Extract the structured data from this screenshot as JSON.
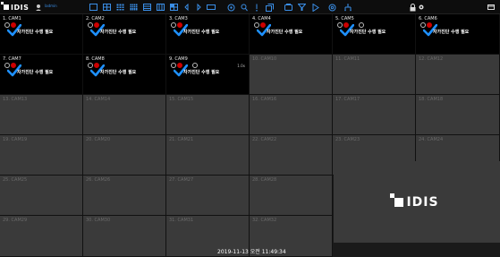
{
  "app": {
    "logo_text": "IDIS",
    "user_label": "Iadmin"
  },
  "timestamp": "2019-11-13 오전 11:49:34",
  "logo_panel_text": "IDIS",
  "cells": [
    {
      "title": "1. CAM1",
      "state": "active",
      "warning": "자가진단 수행 필요",
      "extra": false,
      "speed": ""
    },
    {
      "title": "2. CAM2",
      "state": "active",
      "warning": "자가진단 수행 필요",
      "extra": false,
      "speed": ""
    },
    {
      "title": "3. CAM3",
      "state": "active",
      "warning": "자가진단 수행 필요",
      "extra": false,
      "speed": ""
    },
    {
      "title": "4. CAM4",
      "state": "active",
      "warning": "자가진단 수행 필요",
      "extra": false,
      "speed": ""
    },
    {
      "title": "5. CAM5",
      "state": "active",
      "warning": "자가진단 수행 필요",
      "extra": true,
      "speed": ""
    },
    {
      "title": "6. CAM6",
      "state": "active",
      "warning": "자가진단 수행 필요",
      "extra": false,
      "speed": ""
    },
    {
      "title": "7. CAM7",
      "state": "active",
      "warning": "자가진단 수행 필요",
      "extra": false,
      "speed": ""
    },
    {
      "title": "8. CAM8",
      "state": "active",
      "warning": "자가진단 수행 필요",
      "extra": false,
      "speed": ""
    },
    {
      "title": "9. CAM9",
      "state": "active",
      "warning": "자가진단 수행 필요",
      "extra": true,
      "speed": "1.0x"
    },
    {
      "title": "10. CAM10",
      "state": "empty"
    },
    {
      "title": "11. CAM11",
      "state": "empty"
    },
    {
      "title": "12. CAM12",
      "state": "empty"
    },
    {
      "title": "13. CAM13",
      "state": "empty"
    },
    {
      "title": "14. CAM14",
      "state": "empty"
    },
    {
      "title": "15. CAM15",
      "state": "empty"
    },
    {
      "title": "16. CAM16",
      "state": "empty"
    },
    {
      "title": "17. CAM17",
      "state": "empty"
    },
    {
      "title": "18. CAM18",
      "state": "empty"
    },
    {
      "title": "19. CAM19",
      "state": "empty"
    },
    {
      "title": "20. CAM20",
      "state": "empty"
    },
    {
      "title": "21. CAM21",
      "state": "empty"
    },
    {
      "title": "22. CAM22",
      "state": "empty"
    },
    {
      "title": "23. CAM23",
      "state": "empty"
    },
    {
      "title": "24. CAM24",
      "state": "empty"
    },
    {
      "title": "25. CAM25",
      "state": "empty"
    },
    {
      "title": "26. CAM26",
      "state": "empty"
    },
    {
      "title": "27. CAM27",
      "state": "empty"
    },
    {
      "title": "28. CAM28",
      "state": "empty"
    },
    {
      "title": "29. CAM29",
      "state": "empty"
    },
    {
      "title": "30. CAM30",
      "state": "empty"
    },
    {
      "title": "31. CAM31",
      "state": "empty"
    },
    {
      "title": "32. CAM32",
      "state": "empty"
    }
  ],
  "toolbar_icons": [
    "split-1x1-icon",
    "split-2x2-icon",
    "split-3x3-icon",
    "split-4x4-icon",
    "split-5x5-icon",
    "split-6x6-icon",
    "split-custom-icon",
    "prev-page-icon",
    "next-page-icon",
    "sequence-icon",
    "camera-icon",
    "search-icon",
    "alarm-icon",
    "copy-icon",
    "layout-icon",
    "filter-icon",
    "play-icon",
    "settings-icon",
    "network-icon",
    "lock-icon",
    "gear-icon",
    "minimize-icon"
  ],
  "colors": {
    "active_bg": "#000000",
    "empty_bg": "#3a3a3a",
    "check": "#1e90ff",
    "record": "#cc0000",
    "toolbar_accent": "#3a8ee6"
  }
}
